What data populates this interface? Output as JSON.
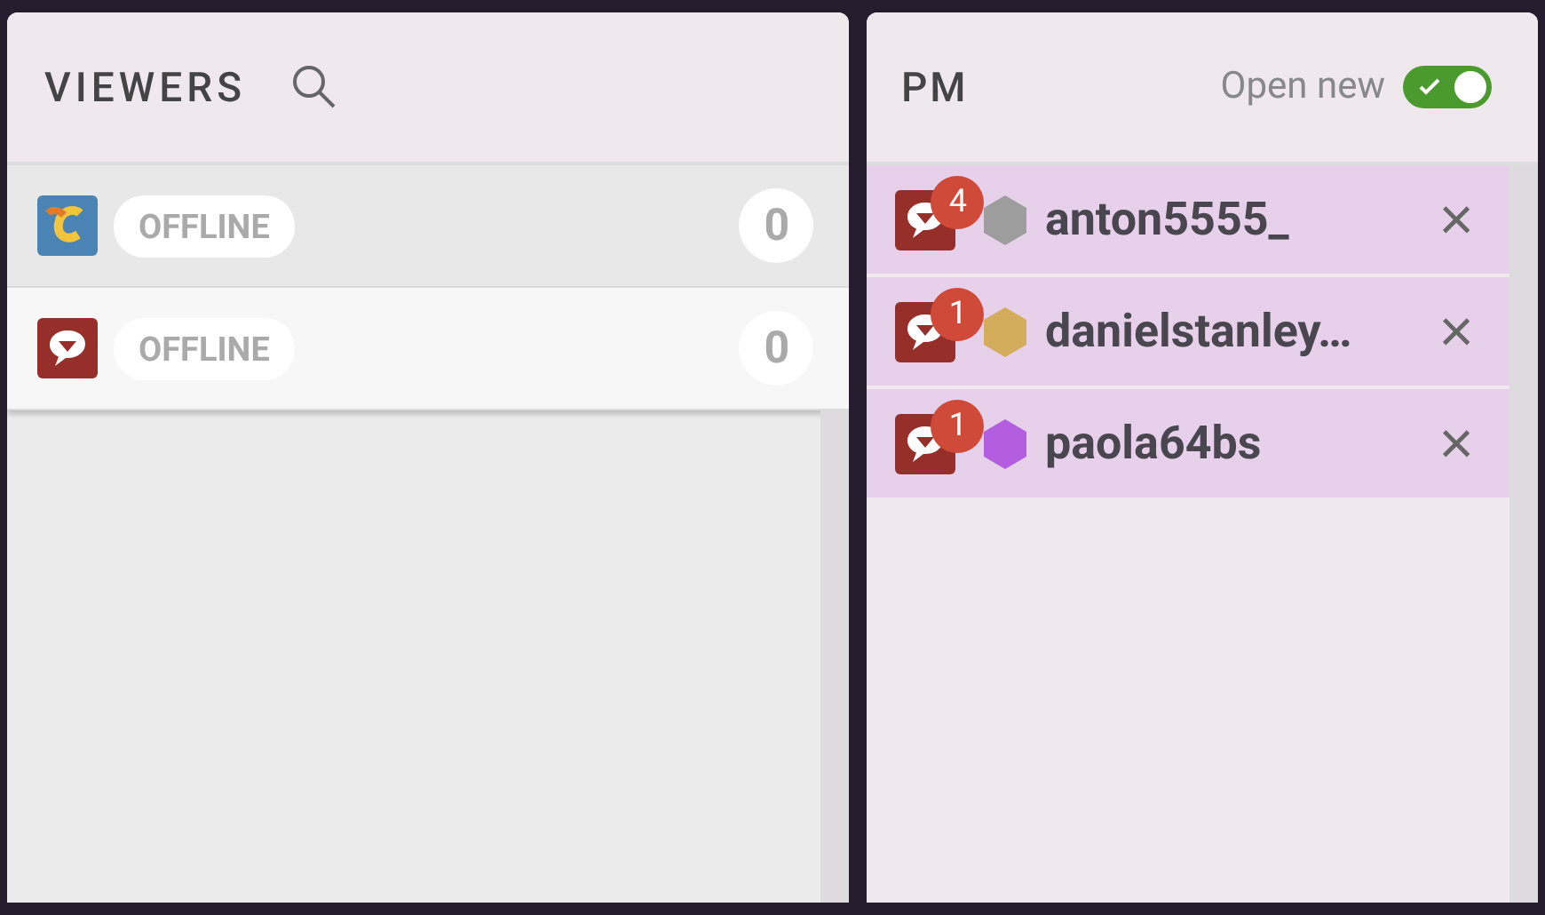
{
  "viewers": {
    "title": "VIEWERS",
    "rows": [
      {
        "kind": "logo",
        "status": "OFFLINE",
        "count": "0",
        "selected": false
      },
      {
        "kind": "chat",
        "status": "OFFLINE",
        "count": "0",
        "selected": true
      }
    ]
  },
  "pm": {
    "title": "PM",
    "open_new": {
      "label": "Open new",
      "on": true
    },
    "chats": [
      {
        "unread": "4",
        "color": "#9e9e9e",
        "name": "anton5555_",
        "close": "×"
      },
      {
        "unread": "1",
        "color": "#d4ad5c",
        "name": "danielstanley…",
        "close": "×"
      },
      {
        "unread": "1",
        "color": "#b35ee0",
        "name": "paola64bs",
        "close": "×"
      }
    ]
  }
}
